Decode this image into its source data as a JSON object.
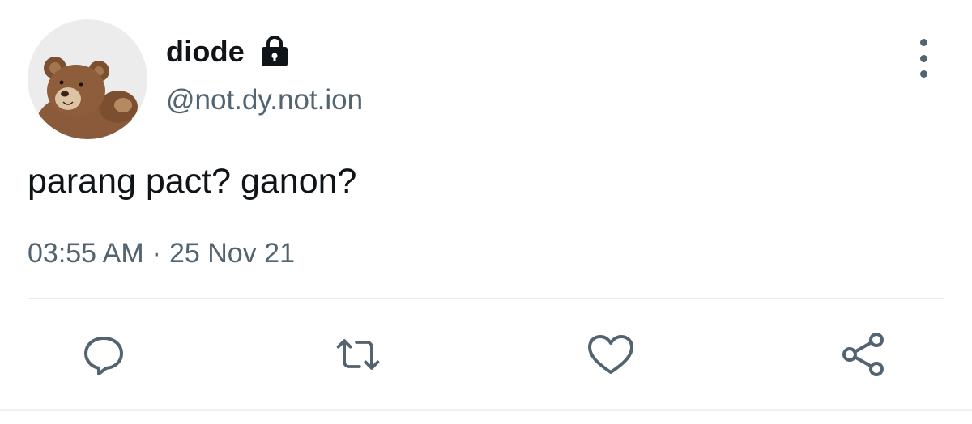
{
  "tweet": {
    "display_name": "diode",
    "handle": "@not.dy.not.ion",
    "text": "parang pact? ganon?",
    "time": "03:55 AM",
    "separator": "·",
    "date": "25 Nov 21",
    "protected": true
  },
  "icons": {
    "avatar": "teddy-bear-avatar",
    "lock": "lock-icon",
    "more": "more-vertical-icon",
    "reply": "reply-icon",
    "retweet": "retweet-icon",
    "like": "heart-icon",
    "share": "share-icon"
  },
  "colors": {
    "primary_text": "#0f1419",
    "secondary_text": "#536471",
    "divider": "#e6ecf0"
  }
}
